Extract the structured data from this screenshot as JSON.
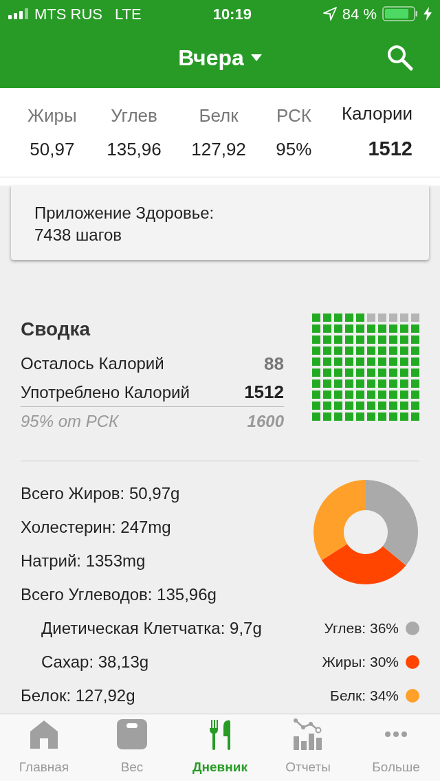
{
  "status_bar": {
    "carrier": "MTS RUS",
    "network": "LTE",
    "time": "10:19",
    "battery": "84 %"
  },
  "header": {
    "title": "Вчера"
  },
  "macros": [
    {
      "label": "Жиры",
      "value": "50,97",
      "kind": "plain"
    },
    {
      "label": "Углев",
      "value": "135,96",
      "kind": "plain"
    },
    {
      "label": "Белк",
      "value": "127,92",
      "kind": "plain"
    },
    {
      "label": "РСК",
      "value": "95%",
      "kind": "plain"
    },
    {
      "label": "Калории",
      "value": "1512",
      "kind": "total"
    }
  ],
  "health_card": {
    "lines": [
      "Приложение Здоровье:",
      "7438 шагов"
    ]
  },
  "summary": {
    "title": "Сводка",
    "rows": [
      {
        "label": "Осталось Калорий",
        "value": "88",
        "kind": "remaining"
      },
      {
        "label": "Употреблено Калорий",
        "value": "1512",
        "kind": "consumed"
      },
      {
        "label": "95% от РСК",
        "value": "1600",
        "kind": "goal"
      }
    ]
  },
  "nutrients": [
    {
      "label": "Всего Жиров: 50,97g"
    },
    {
      "label": "Холестерин: 247mg"
    },
    {
      "label": "Натрий: 1353mg"
    },
    {
      "label": "Всего Углеводов: 135,96g",
      "children": [
        {
          "label": "Диетическая Клетчатка: 9,7g"
        },
        {
          "label": "Сахар: 38,13g"
        }
      ]
    },
    {
      "label": "Белок: 127,92g"
    }
  ],
  "chart_data": {
    "type": "donut",
    "categories": [
      "Углев: 36%",
      "Жиры: 30%",
      "Белк: 34%"
    ],
    "values": [
      36,
      30,
      34
    ]
  },
  "legend": [
    {
      "color": "#aaaaaa"
    },
    {
      "color": "#ff4500"
    },
    {
      "color": "#ffa02a"
    }
  ],
  "tabs": [
    {
      "label": "Главная",
      "kind": "home",
      "selected": false
    },
    {
      "label": "Вес",
      "kind": "scale",
      "selected": false
    },
    {
      "label": "Дневник",
      "kind": "diary",
      "selected": true
    },
    {
      "label": "Отчеты",
      "kind": "reports",
      "selected": false
    },
    {
      "label": "Больше",
      "kind": "more",
      "selected": false
    }
  ]
}
